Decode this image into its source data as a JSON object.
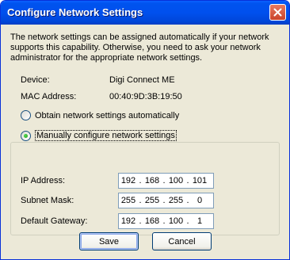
{
  "window": {
    "title": "Configure Network Settings"
  },
  "intro": "The network settings can be assigned automatically if your network supports this capability. Otherwise, you need to ask your network administrator for the appropriate network settings.",
  "device": {
    "label": "Device:",
    "value": "Digi Connect ME"
  },
  "mac": {
    "label": "MAC Address:",
    "value": "00:40:9D:3B:19:50"
  },
  "options": {
    "auto_label": "Obtain network settings automatically",
    "manual_label": "Manually configure network settings",
    "selected": "manual"
  },
  "fields": {
    "ip": {
      "label": "IP Address:",
      "octets": [
        "192",
        "168",
        "100",
        "101"
      ]
    },
    "subnet": {
      "label": "Subnet Mask:",
      "octets": [
        "255",
        "255",
        "255",
        "0"
      ]
    },
    "gateway": {
      "label": "Default Gateway:",
      "octets": [
        "192",
        "168",
        "100",
        "1"
      ]
    }
  },
  "buttons": {
    "save": "Save",
    "cancel": "Cancel"
  },
  "colors": {
    "titlebar": "#0050ee",
    "dialog": "#ece9d8",
    "close": "#c9432a",
    "radio_on": "#21a121"
  }
}
